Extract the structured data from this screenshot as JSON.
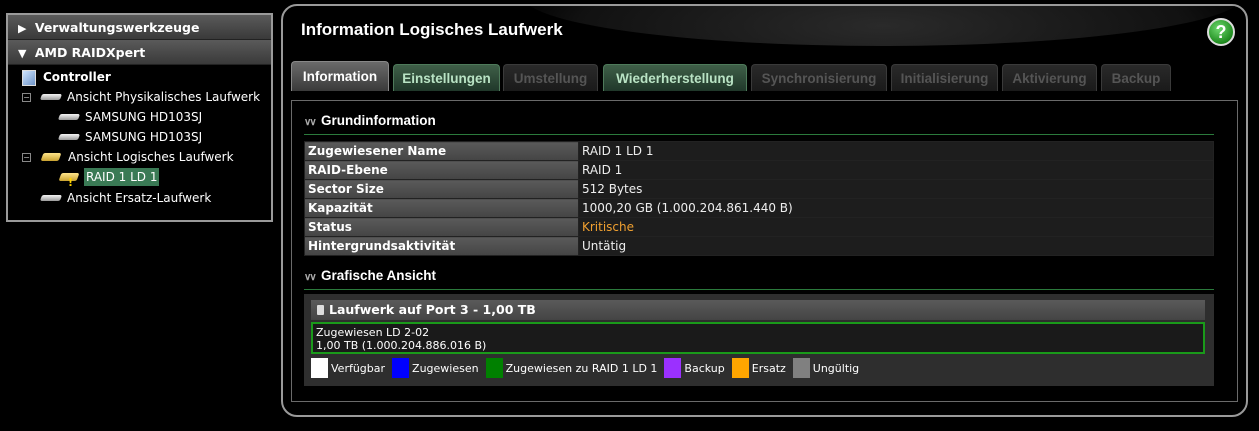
{
  "sidebar": {
    "admin_tools_label": "Verwaltungswerkzeuge",
    "admin_tools_arrow": "▶",
    "raidxpert_label": "AMD RAIDXpert",
    "raidxpert_arrow": "▼",
    "tree": {
      "controller": "Controller",
      "physical_view": "Ansicht Physikalisches Laufwerk",
      "physical_drives": [
        "SAMSUNG HD103SJ",
        "SAMSUNG HD103SJ"
      ],
      "logical_view": "Ansicht Logisches Laufwerk",
      "logical_drive": "RAID 1 LD 1",
      "spare_view": "Ansicht Ersatz-Laufwerk",
      "collapse_symbol": "−"
    }
  },
  "header": {
    "title": "Information Logisches Laufwerk",
    "help_symbol": "?"
  },
  "tabs": [
    {
      "label": "Information",
      "state": "active"
    },
    {
      "label": "Einstellungen",
      "state": "enabled"
    },
    {
      "label": "Umstellung",
      "state": "disabled"
    },
    {
      "label": "Wiederherstellung",
      "state": "enabled"
    },
    {
      "label": "Synchronisierung",
      "state": "disabled"
    },
    {
      "label": "Initialisierung",
      "state": "disabled"
    },
    {
      "label": "Aktivierung",
      "state": "disabled"
    },
    {
      "label": "Backup",
      "state": "disabled"
    }
  ],
  "basic_info": {
    "title": "Grundinformation",
    "rows": [
      {
        "key": "Zugewiesener Name",
        "value": "RAID 1 LD 1"
      },
      {
        "key": "RAID-Ebene",
        "value": "RAID 1"
      },
      {
        "key": "Sector Size",
        "value": "512 Bytes"
      },
      {
        "key": "Kapazität",
        "value": "1000,20 GB (1.000.204.861.440 B)"
      },
      {
        "key": "Status",
        "value": "Kritische"
      },
      {
        "key": "Hintergrundsaktivität",
        "value": "Untätig"
      }
    ]
  },
  "graphic_view": {
    "title": "Grafische Ansicht",
    "drive_label": "Laufwerk auf Port 3 - 1,00 TB",
    "segment_line1": "Zugewiesen LD 2-02",
    "segment_line2": "1,00 TB (1.000.204.886.016 B)",
    "legend": [
      {
        "label": "Verfügbar",
        "color": "#ffffff"
      },
      {
        "label": "Zugewiesen",
        "color": "#0000ff"
      },
      {
        "label": "Zugewiesen zu RAID 1 LD 1",
        "color": "#008000"
      },
      {
        "label": "Backup",
        "color": "#9b30ff"
      },
      {
        "label": "Ersatz",
        "color": "#ffa500"
      },
      {
        "label": "Ungültig",
        "color": "#808080"
      }
    ]
  },
  "colors": {
    "status_critical": "#f0a030",
    "accent_green": "#2b7a3c",
    "selected_item": "#3a7a55"
  }
}
